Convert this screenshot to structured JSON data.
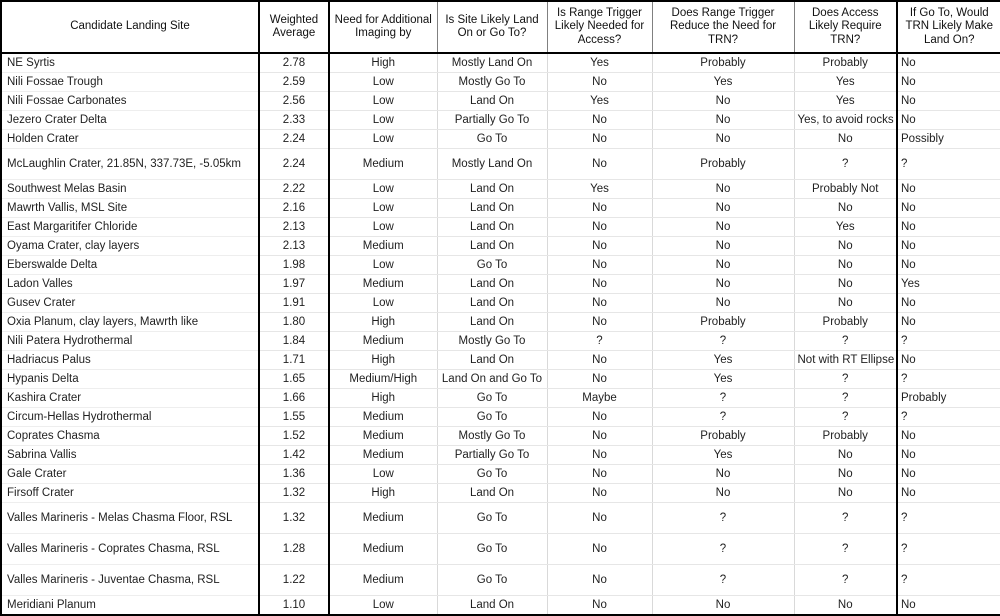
{
  "table": {
    "columns": [
      "Candidate Landing  Site",
      "Weighted Average",
      "Need for Additional Imaging by",
      "Is Site Likely Land On or Go To?",
      "Is Range Trigger Likely Needed for Access?",
      "Does Range Trigger Reduce the Need for TRN?",
      "Does Access Likely Require TRN?",
      "If Go To, Would TRN Likely Make Land On?"
    ],
    "rows": [
      {
        "site": "NE Syrtis",
        "weighted_average": "2.78",
        "imaging_need": "High",
        "land_on_or_go_to": "Mostly Land On",
        "range_trigger_needed": "Yes",
        "range_trigger_reduces_trn": "Probably",
        "access_requires_trn": "Probably",
        "trn_makes_land_on": "No",
        "tall": false
      },
      {
        "site": "Nili Fossae Trough",
        "weighted_average": "2.59",
        "imaging_need": "Low",
        "land_on_or_go_to": "Mostly Go To",
        "range_trigger_needed": "No",
        "range_trigger_reduces_trn": "Yes",
        "access_requires_trn": "Yes",
        "trn_makes_land_on": "No",
        "tall": false
      },
      {
        "site": "Nili Fossae Carbonates",
        "weighted_average": "2.56",
        "imaging_need": "Low",
        "land_on_or_go_to": "Land On",
        "range_trigger_needed": "Yes",
        "range_trigger_reduces_trn": "No",
        "access_requires_trn": "Yes",
        "trn_makes_land_on": "No",
        "tall": false
      },
      {
        "site": "Jezero Crater Delta",
        "weighted_average": "2.33",
        "imaging_need": "Low",
        "land_on_or_go_to": "Partially Go To",
        "range_trigger_needed": "No",
        "range_trigger_reduces_trn": "No",
        "access_requires_trn": "Yes, to avoid rocks",
        "trn_makes_land_on": "No",
        "tall": false
      },
      {
        "site": "Holden Crater",
        "weighted_average": "2.24",
        "imaging_need": "Low",
        "land_on_or_go_to": "Go To",
        "range_trigger_needed": "No",
        "range_trigger_reduces_trn": "No",
        "access_requires_trn": "No",
        "trn_makes_land_on": "Possibly",
        "tall": false
      },
      {
        "site": "McLaughlin Crater, 21.85N, 337.73E, -5.05km",
        "weighted_average": "2.24",
        "imaging_need": "Medium",
        "land_on_or_go_to": "Mostly Land On",
        "range_trigger_needed": "No",
        "range_trigger_reduces_trn": "Probably",
        "access_requires_trn": "?",
        "trn_makes_land_on": "?",
        "tall": true
      },
      {
        "site": "Southwest Melas Basin",
        "weighted_average": "2.22",
        "imaging_need": "Low",
        "land_on_or_go_to": "Land On",
        "range_trigger_needed": "Yes",
        "range_trigger_reduces_trn": "No",
        "access_requires_trn": "Probably Not",
        "trn_makes_land_on": "No",
        "tall": false
      },
      {
        "site": "Mawrth Vallis, MSL Site",
        "weighted_average": "2.16",
        "imaging_need": "Low",
        "land_on_or_go_to": "Land On",
        "range_trigger_needed": "No",
        "range_trigger_reduces_trn": "No",
        "access_requires_trn": "No",
        "trn_makes_land_on": "No",
        "tall": false
      },
      {
        "site": "East Margaritifer Chloride",
        "weighted_average": "2.13",
        "imaging_need": "Low",
        "land_on_or_go_to": "Land On",
        "range_trigger_needed": "No",
        "range_trigger_reduces_trn": "No",
        "access_requires_trn": "Yes",
        "trn_makes_land_on": "No",
        "tall": false
      },
      {
        "site": "Oyama Crater, clay layers",
        "weighted_average": "2.13",
        "imaging_need": "Medium",
        "land_on_or_go_to": "Land On",
        "range_trigger_needed": "No",
        "range_trigger_reduces_trn": "No",
        "access_requires_trn": "No",
        "trn_makes_land_on": "No",
        "tall": false
      },
      {
        "site": "Eberswalde Delta",
        "weighted_average": "1.98",
        "imaging_need": "Low",
        "land_on_or_go_to": "Go To",
        "range_trigger_needed": "No",
        "range_trigger_reduces_trn": "No",
        "access_requires_trn": "No",
        "trn_makes_land_on": "No",
        "tall": false
      },
      {
        "site": "Ladon Valles",
        "weighted_average": "1.97",
        "imaging_need": "Medium",
        "land_on_or_go_to": "Land On",
        "range_trigger_needed": "No",
        "range_trigger_reduces_trn": "No",
        "access_requires_trn": "No",
        "trn_makes_land_on": "Yes",
        "tall": false
      },
      {
        "site": "Gusev Crater",
        "weighted_average": "1.91",
        "imaging_need": "Low",
        "land_on_or_go_to": "Land On",
        "range_trigger_needed": "No",
        "range_trigger_reduces_trn": "No",
        "access_requires_trn": "No",
        "trn_makes_land_on": "No",
        "tall": false
      },
      {
        "site": "Oxia Planum, clay layers, Mawrth like",
        "weighted_average": "1.80",
        "imaging_need": "High",
        "land_on_or_go_to": "Land On",
        "range_trigger_needed": "No",
        "range_trigger_reduces_trn": "Probably",
        "access_requires_trn": "Probably",
        "trn_makes_land_on": "No",
        "tall": false
      },
      {
        "site": "Nili Patera Hydrothermal",
        "weighted_average": "1.84",
        "imaging_need": "Medium",
        "land_on_or_go_to": "Mostly Go To",
        "range_trigger_needed": "?",
        "range_trigger_reduces_trn": "?",
        "access_requires_trn": "?",
        "trn_makes_land_on": "?",
        "tall": false
      },
      {
        "site": "Hadriacus Palus",
        "weighted_average": "1.71",
        "imaging_need": "High",
        "land_on_or_go_to": "Land On",
        "range_trigger_needed": "No",
        "range_trigger_reduces_trn": "Yes",
        "access_requires_trn": "Not with RT Ellipse",
        "trn_makes_land_on": "No",
        "tall": false
      },
      {
        "site": "Hypanis Delta",
        "weighted_average": "1.65",
        "imaging_need": "Medium/High",
        "land_on_or_go_to": "Land On and Go To",
        "range_trigger_needed": "No",
        "range_trigger_reduces_trn": "Yes",
        "access_requires_trn": "?",
        "trn_makes_land_on": "?",
        "tall": false
      },
      {
        "site": "Kashira Crater",
        "weighted_average": "1.66",
        "imaging_need": "High",
        "land_on_or_go_to": "Go To",
        "range_trigger_needed": "Maybe",
        "range_trigger_reduces_trn": "?",
        "access_requires_trn": "?",
        "trn_makes_land_on": "Probably",
        "tall": false
      },
      {
        "site": "Circum-Hellas Hydrothermal",
        "weighted_average": "1.55",
        "imaging_need": "Medium",
        "land_on_or_go_to": "Go To",
        "range_trigger_needed": "No",
        "range_trigger_reduces_trn": "?",
        "access_requires_trn": "?",
        "trn_makes_land_on": "?",
        "tall": false
      },
      {
        "site": "Coprates Chasma",
        "weighted_average": "1.52",
        "imaging_need": "Medium",
        "land_on_or_go_to": "Mostly Go To",
        "range_trigger_needed": "No",
        "range_trigger_reduces_trn": "Probably",
        "access_requires_trn": "Probably",
        "trn_makes_land_on": "No",
        "tall": false
      },
      {
        "site": "Sabrina Vallis",
        "weighted_average": "1.42",
        "imaging_need": "Medium",
        "land_on_or_go_to": "Partially Go To",
        "range_trigger_needed": "No",
        "range_trigger_reduces_trn": "Yes",
        "access_requires_trn": "No",
        "trn_makes_land_on": "No",
        "tall": false
      },
      {
        "site": "Gale Crater",
        "weighted_average": "1.36",
        "imaging_need": "Low",
        "land_on_or_go_to": "Go To",
        "range_trigger_needed": "No",
        "range_trigger_reduces_trn": "No",
        "access_requires_trn": "No",
        "trn_makes_land_on": "No",
        "tall": false
      },
      {
        "site": "Firsoff Crater",
        "weighted_average": "1.32",
        "imaging_need": "High",
        "land_on_or_go_to": "Land On",
        "range_trigger_needed": "No",
        "range_trigger_reduces_trn": "No",
        "access_requires_trn": "No",
        "trn_makes_land_on": "No",
        "tall": false
      },
      {
        "site": "Valles Marineris - Melas Chasma Floor, RSL",
        "weighted_average": "1.32",
        "imaging_need": "Medium",
        "land_on_or_go_to": "Go To",
        "range_trigger_needed": "No",
        "range_trigger_reduces_trn": "?",
        "access_requires_trn": "?",
        "trn_makes_land_on": "?",
        "tall": true
      },
      {
        "site": "Valles Marineris - Coprates Chasma, RSL",
        "weighted_average": "1.28",
        "imaging_need": "Medium",
        "land_on_or_go_to": "Go To",
        "range_trigger_needed": "No",
        "range_trigger_reduces_trn": "?",
        "access_requires_trn": "?",
        "trn_makes_land_on": "?",
        "tall": true
      },
      {
        "site": "Valles Marineris - Juventae Chasma, RSL",
        "weighted_average": "1.22",
        "imaging_need": "Medium",
        "land_on_or_go_to": "Go To",
        "range_trigger_needed": "No",
        "range_trigger_reduces_trn": "?",
        "access_requires_trn": "?",
        "trn_makes_land_on": "?",
        "tall": true
      },
      {
        "site": "Meridiani Planum",
        "weighted_average": "1.10",
        "imaging_need": "Low",
        "land_on_or_go_to": "Land On",
        "range_trigger_needed": "No",
        "range_trigger_reduces_trn": "No",
        "access_requires_trn": "No",
        "trn_makes_land_on": "No",
        "tall": false
      }
    ]
  }
}
